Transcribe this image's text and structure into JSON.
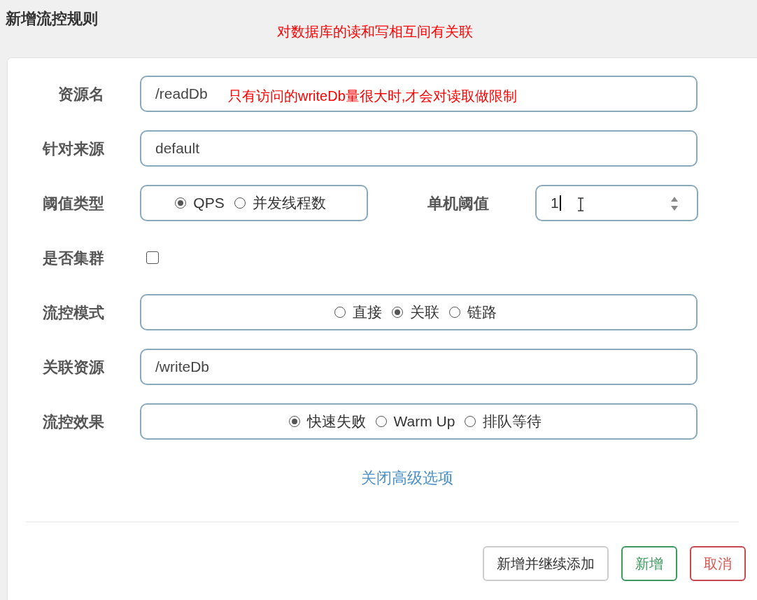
{
  "dialog": {
    "title": "新增流控规则"
  },
  "annotations": [
    {
      "text": "对数据库的读和写相互间有关联"
    }
  ],
  "fields": [
    {
      "kind": "text",
      "label": "资源名",
      "value": "/readDb",
      "annotation": "只有访问的writeDb量很大时,才会对读取做限制"
    },
    {
      "kind": "text",
      "label": "针对来源",
      "value": "default"
    },
    {
      "kind": "threshold",
      "label": "阈值类型",
      "options": [
        {
          "label": "QPS",
          "selected": true
        },
        {
          "label": "并发线程数",
          "selected": false
        }
      ],
      "second_label": "单机阈值",
      "value": "1"
    },
    {
      "kind": "checkbox",
      "label": "是否集群",
      "checked": false
    },
    {
      "kind": "radio",
      "label": "流控模式",
      "options": [
        {
          "label": "直接",
          "selected": false
        },
        {
          "label": "关联",
          "selected": true
        },
        {
          "label": "链路",
          "selected": false
        }
      ]
    },
    {
      "kind": "text",
      "label": "关联资源",
      "value": "/writeDb"
    },
    {
      "kind": "radio",
      "label": "流控效果",
      "options": [
        {
          "label": "快速失败",
          "selected": true
        },
        {
          "label": "Warm Up",
          "selected": false
        },
        {
          "label": "排队等待",
          "selected": false
        }
      ]
    }
  ],
  "toggle_link": "关闭高级选项",
  "buttons": [
    {
      "label": "新增并继续添加",
      "kind": "default"
    },
    {
      "label": "新增",
      "kind": "primary"
    },
    {
      "label": "取消",
      "kind": "danger"
    }
  ]
}
